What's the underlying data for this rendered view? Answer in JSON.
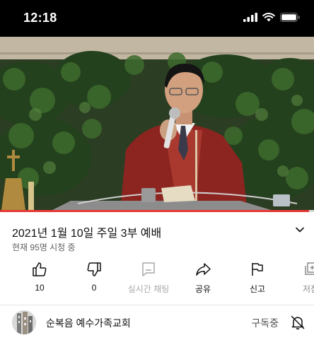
{
  "status_bar": {
    "time": "12:18",
    "icons": [
      "cellular-signal-icon",
      "wifi-icon",
      "battery-icon"
    ]
  },
  "video": {
    "description_icon": "video-player",
    "progress": 0.985,
    "progress_color": "#e53935"
  },
  "video_info": {
    "title": "2021년 1월 10일 주일 3부 예배",
    "viewers": "현재 95명 시청 중"
  },
  "actions": [
    {
      "icon": "thumbs-up-icon",
      "label": "10"
    },
    {
      "icon": "thumbs-down-icon",
      "label": "0"
    },
    {
      "icon": "live-chat-icon",
      "label": "실시간 채팅"
    },
    {
      "icon": "share-icon",
      "label": "공유"
    },
    {
      "icon": "flag-icon",
      "label": "신고"
    },
    {
      "icon": "save-icon",
      "label": "저장"
    }
  ],
  "channel": {
    "name": "순복음 예수가족교회",
    "subscribe_state": "구독중"
  }
}
